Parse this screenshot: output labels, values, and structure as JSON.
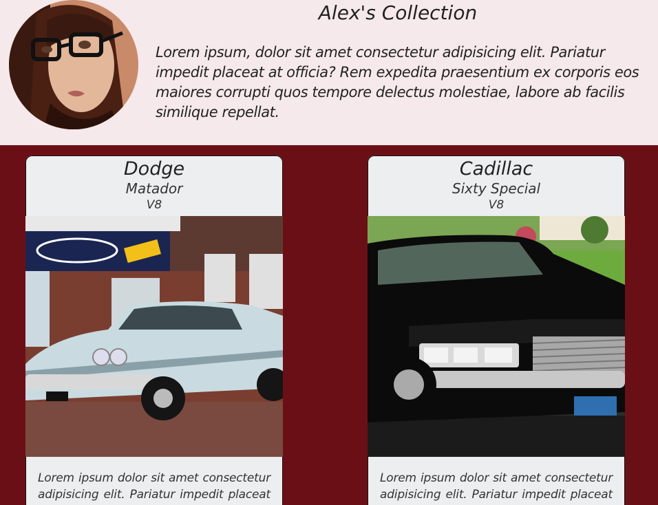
{
  "header": {
    "title": "Alex's Collection",
    "description": "Lorem ipsum, dolor sit amet consectetur adipisicing elit. Pariatur impedit placeat at officia? Rem expedita praesentium ex corporis eos maiores corrupti quos tempore delectus molestiae, labore ab facilis similique repellat."
  },
  "cards": [
    {
      "make": "Dodge",
      "model": "Matador",
      "engine": "V8",
      "description": "Lorem ipsum dolor sit amet consectetur adipisicing elit. Pariatur impedit placeat at"
    },
    {
      "make": "Cadillac",
      "model": "Sixty Special",
      "engine": "V8",
      "description": "Lorem ipsum dolor sit amet consectetur adipisicing elit. Pariatur impedit placeat at"
    }
  ],
  "colors": {
    "header_bg": "#f6e9eb",
    "gallery_bg": "#6b0f16",
    "card_bg": "#eceef0"
  },
  "icons": {
    "avatar": "profile-photo",
    "card_1_photo": "car-photo",
    "card_2_photo": "car-photo"
  }
}
